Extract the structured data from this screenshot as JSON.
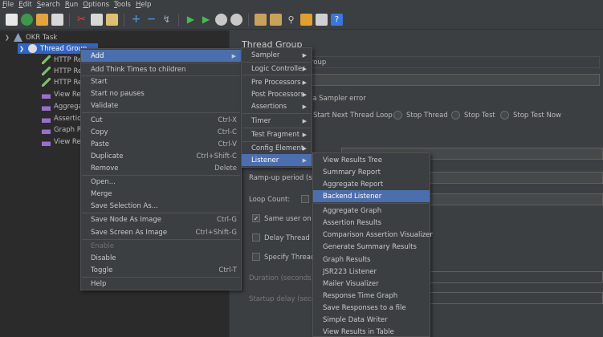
{
  "menubar": [
    "File",
    "Edit",
    "Search",
    "Run",
    "Options",
    "Tools",
    "Help"
  ],
  "tree": {
    "root": "OKR Task",
    "thread_group": "Thread Group",
    "children": [
      "HTTP Re",
      "HTTP Re",
      "HTTP Re",
      "View Res",
      "Aggrega",
      "Assertio",
      "Graph R",
      "View Res"
    ]
  },
  "panel": {
    "title": "Thread Group",
    "name_partial": "roup",
    "sampler_error_partial": "r a Sampler error",
    "radios": [
      "Start Next Thread Loop",
      "Stop Thread",
      "Stop Test",
      "Stop Test Now"
    ],
    "rampup_partial": "Ramp-up period (se",
    "loop_count": "Loop Count:",
    "same_user_partial": "Same user on e",
    "delay_thread_partial": "Delay Thread c",
    "specify_thread_partial": "Specify Thread",
    "duration_partial": "Duration (seconds):",
    "startup_delay_partial": "Startup delay (secon"
  },
  "context_menu": {
    "items": [
      {
        "label": "Add",
        "shortcut": "",
        "submenu": true,
        "highlight": true
      },
      {
        "label": "Add Think Times to children",
        "shortcut": ""
      },
      {
        "label": "Start",
        "shortcut": ""
      },
      {
        "label": "Start no pauses",
        "shortcut": ""
      },
      {
        "label": "Validate",
        "shortcut": ""
      },
      {
        "label": "Cut",
        "shortcut": "Ctrl-X"
      },
      {
        "label": "Copy",
        "shortcut": "Ctrl-C"
      },
      {
        "label": "Paste",
        "shortcut": "Ctrl-V"
      },
      {
        "label": "Duplicate",
        "shortcut": "Ctrl+Shift-C"
      },
      {
        "label": "Remove",
        "shortcut": "Delete"
      },
      {
        "label": "Open...",
        "shortcut": ""
      },
      {
        "label": "Merge",
        "shortcut": ""
      },
      {
        "label": "Save Selection As...",
        "shortcut": ""
      },
      {
        "label": "Save Node As Image",
        "shortcut": "Ctrl-G"
      },
      {
        "label": "Save Screen As Image",
        "shortcut": "Ctrl+Shift-G"
      },
      {
        "label": "Enable",
        "shortcut": "",
        "disabled": true
      },
      {
        "label": "Disable",
        "shortcut": ""
      },
      {
        "label": "Toggle",
        "shortcut": "Ctrl-T"
      },
      {
        "label": "Help",
        "shortcut": ""
      }
    ]
  },
  "add_submenu": {
    "items": [
      "Sampler",
      "Logic Controller",
      "Pre Processors",
      "Post Processors",
      "Assertions",
      "Timer",
      "Test Fragment",
      "Config Element",
      "Listener"
    ]
  },
  "listener_submenu": {
    "items": [
      "View Results Tree",
      "Summary Report",
      "Aggregate Report",
      "Backend Listener",
      "Aggregate Graph",
      "Assertion Results",
      "Comparison Assertion Visualizer",
      "Generate Summary Results",
      "Graph Results",
      "JSR223 Listener",
      "Mailer Visualizer",
      "Response Time Graph",
      "Save Responses to a file",
      "Simple Data Writer",
      "View Results in Table"
    ]
  },
  "colors": {
    "highlight": "#4b6eaf",
    "tree_selection": "#2f65ca",
    "background": "#3c3f41"
  }
}
